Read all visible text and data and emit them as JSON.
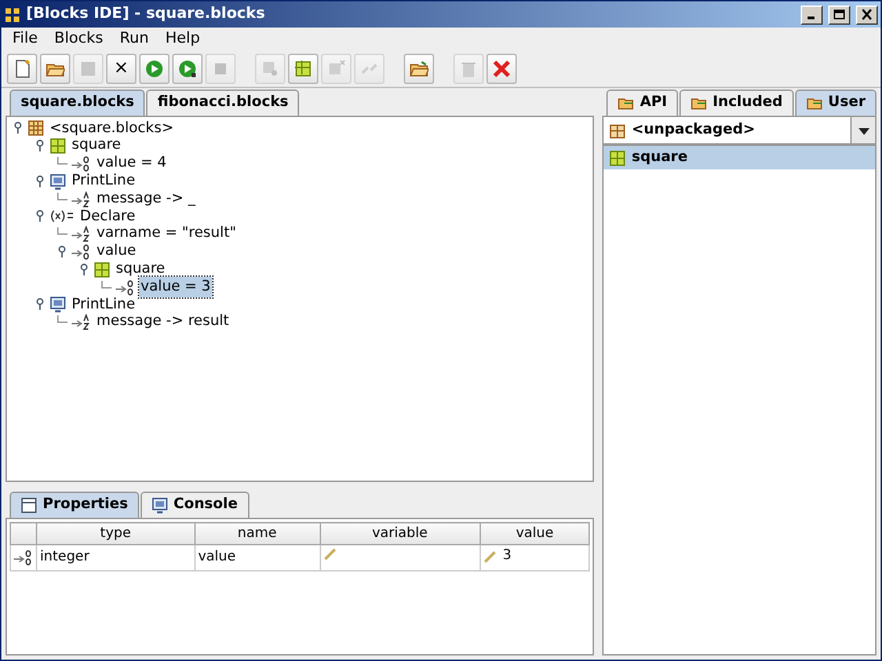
{
  "window": {
    "title": "[Blocks IDE] - square.blocks"
  },
  "menu": [
    "File",
    "Blocks",
    "Run",
    "Help"
  ],
  "toolbar": [
    {
      "kind": "new",
      "disabled": false
    },
    {
      "kind": "open",
      "disabled": false
    },
    {
      "kind": "square",
      "disabled": true
    },
    {
      "kind": "text",
      "label": "×",
      "disabled": false
    },
    {
      "kind": "run",
      "disabled": false
    },
    {
      "kind": "debug",
      "disabled": false
    },
    {
      "kind": "stop",
      "disabled": true
    },
    {
      "kind": "gap"
    },
    {
      "kind": "zoom",
      "disabled": true
    },
    {
      "kind": "block",
      "disabled": false
    },
    {
      "kind": "remove",
      "disabled": true
    },
    {
      "kind": "link",
      "disabled": true
    },
    {
      "kind": "gap"
    },
    {
      "kind": "folder",
      "disabled": false
    },
    {
      "kind": "gap"
    },
    {
      "kind": "trash",
      "disabled": true
    },
    {
      "kind": "delete",
      "disabled": false
    }
  ],
  "editor_tabs": [
    {
      "label": "square.blocks",
      "selected": true
    },
    {
      "label": "fibonacci.blocks",
      "selected": false
    }
  ],
  "tree": {
    "label": "<square.blocks>",
    "kind": "root",
    "expanded": true,
    "selected": false,
    "children": [
      {
        "label": "square",
        "kind": "block",
        "expanded": true,
        "selected": false,
        "children": [
          {
            "label": "value = 4",
            "kind": "number",
            "selected": false
          }
        ]
      },
      {
        "label": "PrintLine",
        "kind": "print",
        "expanded": true,
        "selected": false,
        "children": [
          {
            "label": "message -> _",
            "kind": "text",
            "selected": false
          }
        ]
      },
      {
        "label": "Declare",
        "kind": "declare",
        "expanded": true,
        "selected": false,
        "children": [
          {
            "label": "varname = \"result\"",
            "kind": "text",
            "selected": false
          },
          {
            "label": "value",
            "kind": "number",
            "expanded": true,
            "selected": false,
            "children": [
              {
                "label": "square",
                "kind": "block",
                "expanded": true,
                "selected": false,
                "children": [
                  {
                    "label": "value = 3",
                    "kind": "number",
                    "selected": true
                  }
                ]
              }
            ]
          }
        ]
      },
      {
        "label": "PrintLine",
        "kind": "print",
        "expanded": true,
        "selected": false,
        "children": [
          {
            "label": "message -> result",
            "kind": "text",
            "selected": false
          }
        ]
      }
    ]
  },
  "bottom_tabs": [
    {
      "label": "Properties",
      "kind": "table",
      "selected": true
    },
    {
      "label": "Console",
      "kind": "console",
      "selected": false
    }
  ],
  "properties": {
    "columns": [
      "type",
      "name",
      "variable",
      "value"
    ],
    "rows": [
      {
        "kind": "number",
        "type": "integer",
        "name": "value",
        "variable": "",
        "value": "3"
      }
    ]
  },
  "library_tabs": [
    {
      "label": "API",
      "selected": false
    },
    {
      "label": "Included",
      "selected": false
    },
    {
      "label": "User",
      "selected": true
    }
  ],
  "package_combo": {
    "value": "<unpackaged>"
  },
  "library_items": [
    {
      "label": "square",
      "kind": "block",
      "selected": true
    }
  ]
}
